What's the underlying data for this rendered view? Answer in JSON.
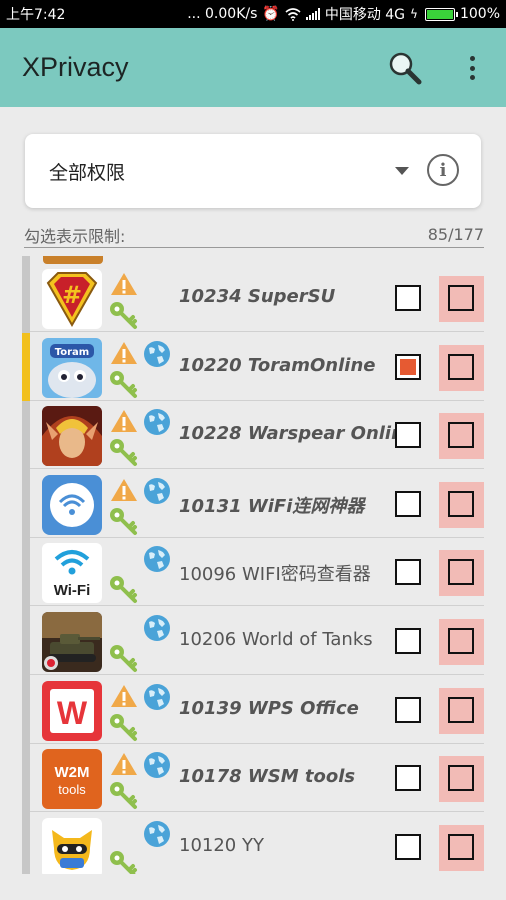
{
  "status_bar": {
    "time": "上午7:42",
    "speed": "... 0.00K/s",
    "carrier": "中国移动 4G",
    "battery": "100%",
    "battery_level": 1.0
  },
  "app_bar": {
    "title": "XPrivacy",
    "search_icon": "search-icon",
    "menu_icon": "more-vert-icon"
  },
  "restriction_spinner": {
    "selected": "全部权限",
    "info_icon": "info-icon"
  },
  "list_header": {
    "label": "勾选表示限制:",
    "count": "85/177"
  },
  "colors": {
    "app_bar": "#7cc9bf",
    "highlight_bar": "#f2c01d",
    "checked_fill": "#e65a32",
    "second_checkbox_bg": "#f2bbb6",
    "warning": "#f0a848",
    "key": "#8fbf4d",
    "globe": "#4aa3d8"
  },
  "apps": [
    {
      "label": "10234 SuperSU",
      "icon": "supersu",
      "warning": true,
      "internet": false,
      "bold": true,
      "checked": false,
      "highlight": false
    },
    {
      "label": "10220 ToramOnline",
      "icon": "toram",
      "warning": true,
      "internet": true,
      "bold": true,
      "checked": true,
      "highlight": true
    },
    {
      "label": "10228 Warspear Online",
      "icon": "warspear",
      "warning": true,
      "internet": true,
      "bold": true,
      "checked": false,
      "highlight": false
    },
    {
      "label": "10131 WiFi连网神器",
      "icon": "wifi-connect",
      "warning": true,
      "internet": true,
      "bold": true,
      "checked": false,
      "highlight": false
    },
    {
      "label": "10096 WIFI密码查看器",
      "icon": "wifi-password",
      "warning": false,
      "internet": true,
      "bold": false,
      "checked": false,
      "highlight": false
    },
    {
      "label": "10206 World of Tanks",
      "icon": "tanks",
      "warning": false,
      "internet": true,
      "bold": false,
      "checked": false,
      "highlight": false
    },
    {
      "label": "10139 WPS Office",
      "icon": "wps",
      "warning": true,
      "internet": true,
      "bold": true,
      "checked": false,
      "highlight": false
    },
    {
      "label": "10178 WSM tools",
      "icon": "wsm",
      "warning": true,
      "internet": true,
      "bold": true,
      "checked": false,
      "highlight": false
    },
    {
      "label": "10120 YY",
      "icon": "yy",
      "warning": false,
      "internet": true,
      "bold": false,
      "checked": false,
      "highlight": false
    }
  ],
  "app_icon_text": {
    "wifi-password": "Wi-Fi",
    "wps": "W",
    "wsm": "W2M tools"
  }
}
